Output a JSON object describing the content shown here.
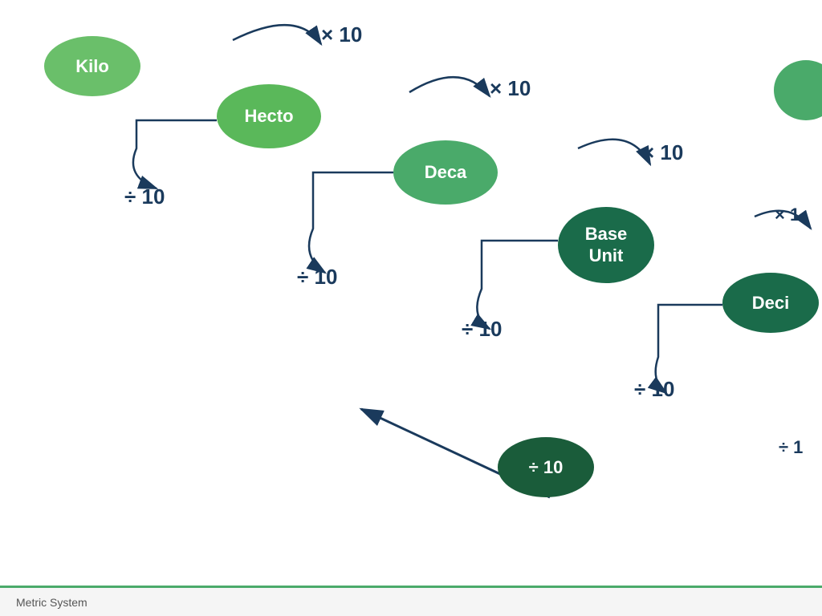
{
  "nodes": {
    "kilo": {
      "label": "Kilo"
    },
    "hecto": {
      "label": "Hecto"
    },
    "deca": {
      "label": "Deca"
    },
    "base": {
      "label": "Base\nUnit"
    },
    "deci": {
      "label": "Deci"
    },
    "div10_circle": {
      "label": "÷ 10"
    }
  },
  "multipliers": {
    "x10_1": "× 10",
    "x10_2": "× 10",
    "x10_3": "× 10",
    "x10_4": "× 1",
    "div10_1": "÷ 10",
    "div10_2": "÷ 10",
    "div10_3": "÷ 10",
    "div10_4": "÷ 10",
    "div10_5": "÷ 1"
  },
  "footer": {
    "text": "Metric System"
  },
  "accent_color": "#4aaa6a"
}
